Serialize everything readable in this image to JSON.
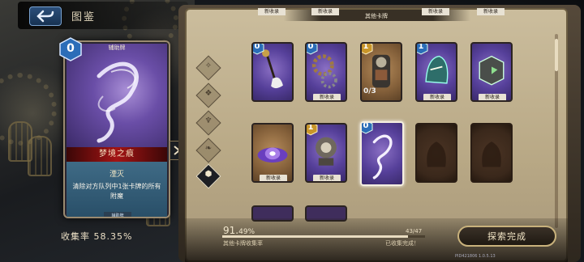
{
  "header": {
    "title": "图鉴"
  },
  "featured_card": {
    "cost": "0",
    "type": "辅助牌",
    "name": "梦境之痕",
    "keyword": "湮灭",
    "description": "清除对方队列中1张卡牌的所有附魔",
    "sub_tag": "辅助牌"
  },
  "collection": {
    "label": "收集率",
    "rate": "58.35%"
  },
  "panel": {
    "title": "其他卡牌",
    "top_new_labels": [
      "新收录",
      "新收录",
      "新收录",
      "新收录"
    ],
    "category_glyphs": [
      "✧",
      "❖",
      "♆",
      "❧",
      "⬢"
    ],
    "cards": [
      {
        "cost": "0",
        "color": "purple",
        "new": "",
        "count": ""
      },
      {
        "cost": "0",
        "color": "purple",
        "new": "新收录",
        "count": ""
      },
      {
        "cost": "1",
        "color": "brown",
        "new": "",
        "count": "0/3"
      },
      {
        "cost": "1",
        "color": "purple",
        "new": "新收录",
        "count": ""
      },
      {
        "cost": "0",
        "color": "purple",
        "new": "新收录",
        "count": ""
      },
      {
        "cost": "",
        "color": "brown",
        "new": "新收录",
        "count": ""
      },
      {
        "cost": "1",
        "color": "purple",
        "new": "新收录",
        "count": ""
      },
      {
        "cost": "0",
        "color": "purple",
        "new": "",
        "count": ""
      },
      {
        "cost": "",
        "color": "empty",
        "new": "",
        "count": ""
      },
      {
        "cost": "",
        "color": "empty",
        "new": "",
        "count": ""
      }
    ]
  },
  "progress": {
    "percent_main": "91.",
    "percent_frac": "49%",
    "fraction_value": 0.9149,
    "count": "43/47",
    "label": "其他卡牌收集率",
    "status": "已收集完成！"
  },
  "explore_button": "探索完成",
  "footer_id": "PID421806  1.0.5.13",
  "colors": {
    "accent_gold": "#c9b27c",
    "name_red": "#a31414",
    "desc_blue": "#3f6b86",
    "card_purple": "#56409a"
  }
}
